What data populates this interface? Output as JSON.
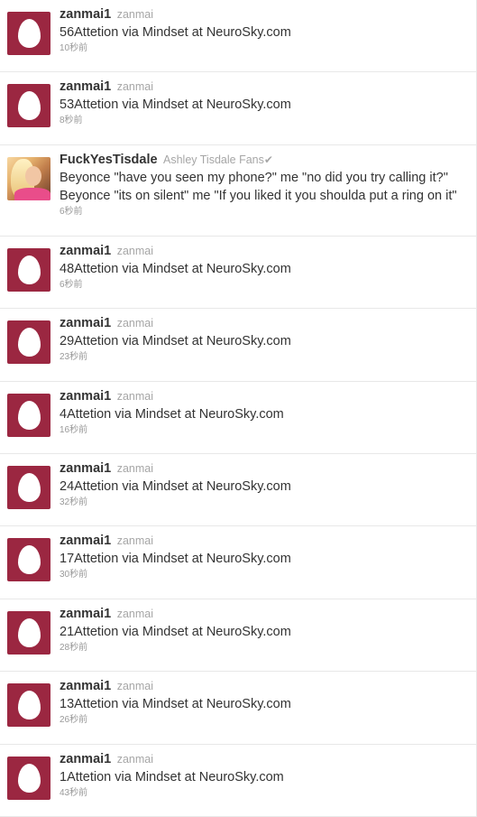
{
  "tweets": [
    {
      "name": "zanmai1",
      "handle": "zanmai",
      "text": "56Attetion via Mindset at NeuroSky.com",
      "time": "10秒前",
      "avatar": "egg-icon"
    },
    {
      "name": "zanmai1",
      "handle": "zanmai",
      "text": "53Attetion via Mindset at NeuroSky.com",
      "time": "8秒前",
      "avatar": "egg-icon"
    },
    {
      "name": "FuckYesTisdale",
      "handle": "Ashley Tisdale Fans",
      "verified": "✔",
      "text": "Beyonce \"have you seen my phone?\" me \"no did you try calling it?\"",
      "text2": "Beyonce \"its on silent\" me \"If you liked it you shoulda put a ring on it\"",
      "time": "6秒前",
      "avatar": "user-photo"
    },
    {
      "name": "zanmai1",
      "handle": "zanmai",
      "text": "48Attetion via Mindset at NeuroSky.com",
      "time": "6秒前",
      "avatar": "egg-icon"
    },
    {
      "name": "zanmai1",
      "handle": "zanmai",
      "text": "29Attetion via Mindset at NeuroSky.com",
      "time": "23秒前",
      "avatar": "egg-icon"
    },
    {
      "name": "zanmai1",
      "handle": "zanmai",
      "text": "4Attetion via Mindset at NeuroSky.com",
      "time": "16秒前",
      "avatar": "egg-icon"
    },
    {
      "name": "zanmai1",
      "handle": "zanmai",
      "text": "24Attetion via Mindset at NeuroSky.com",
      "time": "32秒前",
      "avatar": "egg-icon"
    },
    {
      "name": "zanmai1",
      "handle": "zanmai",
      "text": "17Attetion via Mindset at NeuroSky.com",
      "time": "30秒前",
      "avatar": "egg-icon"
    },
    {
      "name": "zanmai1",
      "handle": "zanmai",
      "text": "21Attetion via Mindset at NeuroSky.com",
      "time": "28秒前",
      "avatar": "egg-icon"
    },
    {
      "name": "zanmai1",
      "handle": "zanmai",
      "text": "13Attetion via Mindset at NeuroSky.com",
      "time": "26秒前",
      "avatar": "egg-icon"
    },
    {
      "name": "zanmai1",
      "handle": "zanmai",
      "text": "1Attetion via Mindset at NeuroSky.com",
      "time": "43秒前",
      "avatar": "egg-icon"
    }
  ],
  "colors": {
    "avatar_bg": "#9b2741",
    "text": "#333333",
    "muted": "#a6a6a6"
  }
}
